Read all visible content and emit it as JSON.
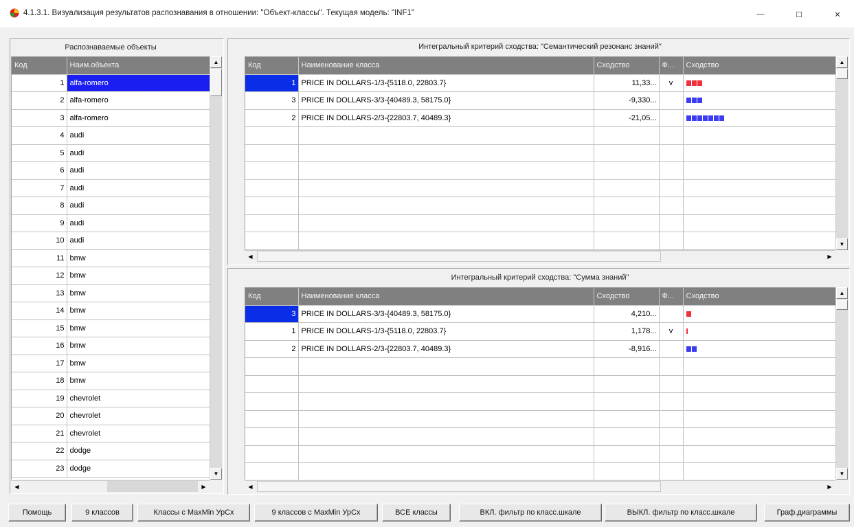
{
  "window": {
    "title": "4.1.3.1. Визуализация результатов распознавания в отношении: \"Объект-классы\". Текущая модель: \"INF1\"",
    "min_glyph": "—",
    "max_glyph": "☐",
    "close_glyph": "✕"
  },
  "objects_panel": {
    "caption": "Распознаваемые объекты",
    "col_code": "Код",
    "col_name": "Наим.объекта",
    "rows": [
      {
        "code": "1",
        "name": "alfa-romero"
      },
      {
        "code": "2",
        "name": "alfa-romero"
      },
      {
        "code": "3",
        "name": "alfa-romero"
      },
      {
        "code": "4",
        "name": "audi"
      },
      {
        "code": "5",
        "name": "audi"
      },
      {
        "code": "6",
        "name": "audi"
      },
      {
        "code": "7",
        "name": "audi"
      },
      {
        "code": "8",
        "name": "audi"
      },
      {
        "code": "9",
        "name": "audi"
      },
      {
        "code": "10",
        "name": "audi"
      },
      {
        "code": "11",
        "name": "bmw"
      },
      {
        "code": "12",
        "name": "bmw"
      },
      {
        "code": "13",
        "name": "bmw"
      },
      {
        "code": "14",
        "name": "bmw"
      },
      {
        "code": "15",
        "name": "bmw"
      },
      {
        "code": "16",
        "name": "bmw"
      },
      {
        "code": "17",
        "name": "bmw"
      },
      {
        "code": "18",
        "name": "bmw"
      },
      {
        "code": "19",
        "name": "chevrolet"
      },
      {
        "code": "20",
        "name": "chevrolet"
      },
      {
        "code": "21",
        "name": "chevrolet"
      },
      {
        "code": "22",
        "name": "dodge"
      },
      {
        "code": "23",
        "name": "dodge"
      }
    ]
  },
  "semantic_panel": {
    "caption": "Интегральный критерий сходства: \"Семантический резонанс знаний\"",
    "col_code": "Код",
    "col_name": "Наименование класса",
    "col_sim": "Сходство",
    "col_flag": "Ф...",
    "col_bar": "Сходство",
    "rows": [
      {
        "code": "1",
        "name": "PRICE IN DOLLARS-1/3-{5118.0, 22803.7}",
        "sim": "11,33...",
        "flag": "v",
        "bar_color": "#f0303c",
        "bar_segments": 3
      },
      {
        "code": "3",
        "name": "PRICE IN DOLLARS-3/3-{40489.3, 58175.0}",
        "sim": "-9,330...",
        "flag": "",
        "bar_color": "#3c3cf0",
        "bar_segments": 3
      },
      {
        "code": "2",
        "name": "PRICE IN DOLLARS-2/3-{22803.7, 40489.3}",
        "sim": "-21,05...",
        "flag": "",
        "bar_color": "#3c3cf0",
        "bar_segments": 7
      }
    ]
  },
  "sum_panel": {
    "caption": "Интегральный критерий сходства: \"Сумма знаний\"",
    "col_code": "Код",
    "col_name": "Наименование класса",
    "col_sim": "Сходство",
    "col_flag": "Ф...",
    "col_bar": "Сходство",
    "rows": [
      {
        "code": "3",
        "name": "PRICE IN DOLLARS-3/3-{40489.3, 58175.0}",
        "sim": "4,210...",
        "flag": "",
        "bar_color": "#f0303c",
        "bar_segments": 1
      },
      {
        "code": "1",
        "name": "PRICE IN DOLLARS-1/3-{5118.0, 22803.7}",
        "sim": "1,178...",
        "flag": "v",
        "bar_color": "#f0303c",
        "bar_segments": 0.3
      },
      {
        "code": "2",
        "name": "PRICE IN DOLLARS-2/3-{22803.7, 40489.3}",
        "sim": "-8,916...",
        "flag": "",
        "bar_color": "#3c3cf0",
        "bar_segments": 2
      }
    ]
  },
  "buttons": {
    "help": "Помощь",
    "nine_classes": "9 классов",
    "classes_maxmin": "Классы с MaxMin УрСх",
    "nine_classes_maxmin": "9 классов с MaxMin УрСх",
    "all_classes": "ВСЕ классы",
    "filter_on": "ВКЛ. фильтр по класс.шкале",
    "filter_off": "ВЫКЛ. фильтр по класс.шкале",
    "graph": "Граф.диаграммы"
  },
  "arrows": {
    "up": "▲",
    "down": "▼",
    "left": "◀",
    "right": "▶"
  }
}
